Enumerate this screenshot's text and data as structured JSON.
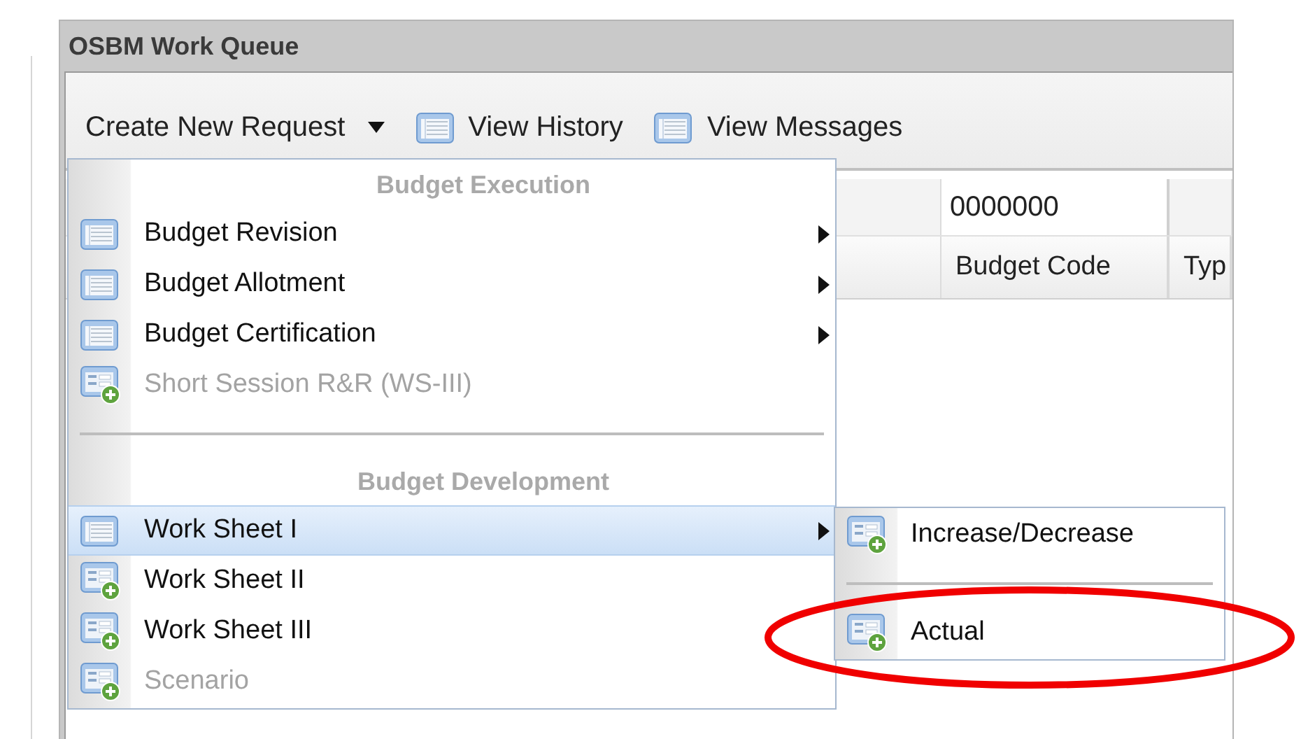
{
  "window": {
    "title": "OSBM Work Queue"
  },
  "toolbar": [
    {
      "label": "Create New Request",
      "kind": "dropdown"
    },
    {
      "label": "View History",
      "kind": "icon"
    },
    {
      "label": "View Messages",
      "kind": "icon"
    }
  ],
  "grid": {
    "filter_value": "0000000",
    "columns": [
      "Budget Code",
      "Typ"
    ]
  },
  "menu": [
    {
      "kind": "header",
      "label": "Budget Execution"
    },
    {
      "kind": "list",
      "label": "Budget Revision",
      "submenu": true,
      "disabled": false,
      "selected": false
    },
    {
      "kind": "list",
      "label": "Budget Allotment",
      "submenu": true,
      "disabled": false,
      "selected": false
    },
    {
      "kind": "list",
      "label": "Budget Certification",
      "submenu": true,
      "disabled": false,
      "selected": false
    },
    {
      "kind": "form",
      "label": "Short Session R&R (WS-III)",
      "submenu": false,
      "disabled": true,
      "selected": false
    },
    {
      "kind": "separator"
    },
    {
      "kind": "header",
      "label": "Budget Development"
    },
    {
      "kind": "list",
      "label": "Work Sheet I",
      "submenu": true,
      "disabled": false,
      "selected": true
    },
    {
      "kind": "form",
      "label": "Work Sheet II",
      "submenu": false,
      "disabled": false,
      "selected": false
    },
    {
      "kind": "form",
      "label": "Work Sheet III",
      "submenu": false,
      "disabled": false,
      "selected": false
    },
    {
      "kind": "form",
      "label": "Scenario",
      "submenu": false,
      "disabled": true,
      "selected": false
    }
  ],
  "submenu": [
    {
      "kind": "form",
      "label": "Increase/Decrease",
      "submenu": false,
      "disabled": false,
      "selected": false
    },
    {
      "kind": "separator"
    },
    {
      "kind": "form",
      "label": "Actual",
      "submenu": false,
      "disabled": false,
      "selected": false
    }
  ],
  "annotation": {
    "kind": "ellipse"
  }
}
